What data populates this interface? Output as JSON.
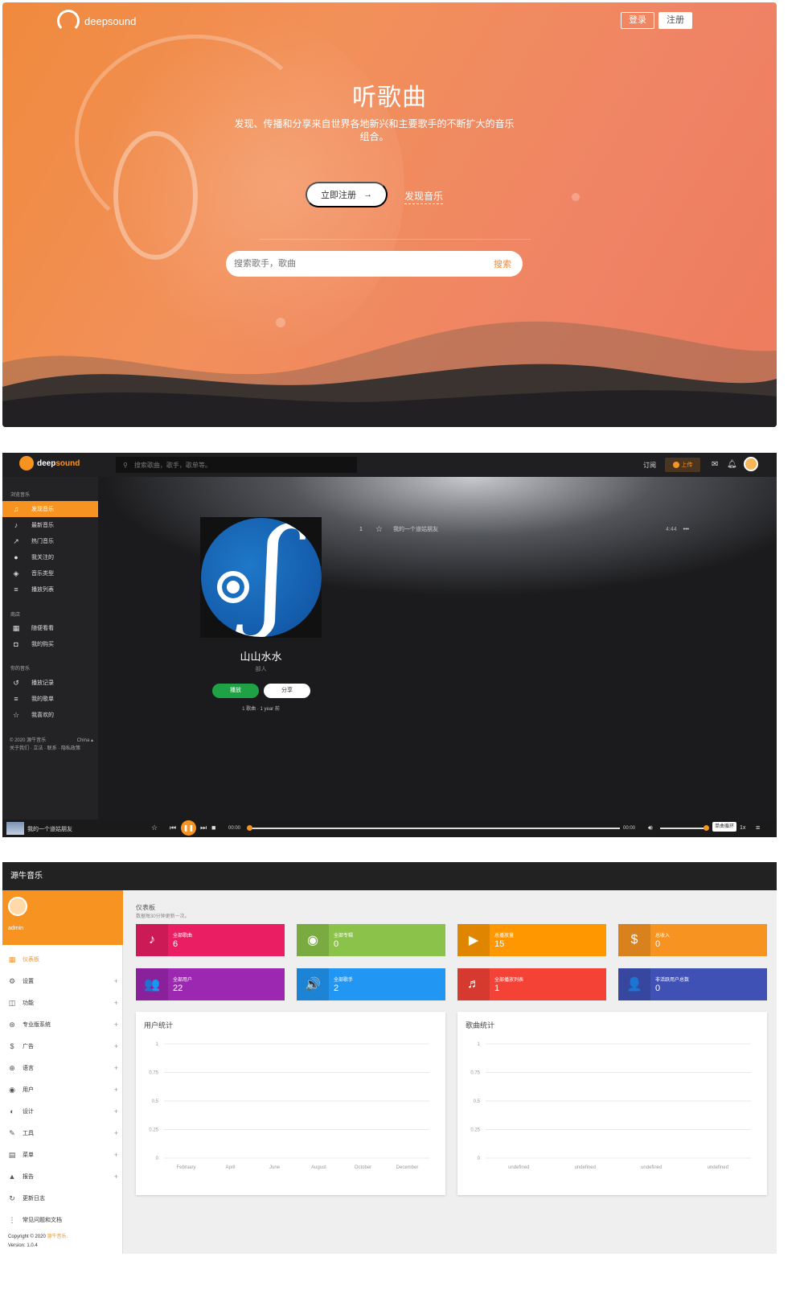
{
  "hero": {
    "brand": "deepsound",
    "login": "登录",
    "register": "注册",
    "title": "听歌曲",
    "subtitle": "发现、传播和分享来自世界各地新兴和主要歌手的不断扩大的音乐组合。",
    "cta": "立即注册",
    "discover": "发现音乐",
    "search_placeholder": "搜索歌手，歌曲",
    "search_button": "搜索"
  },
  "player": {
    "brand_a": "deep",
    "brand_b": "sound",
    "search_placeholder": "搜索歌曲，歌手，歌单等。",
    "subscribe": "订阅",
    "upload": "上传",
    "sections": [
      "浏览音乐",
      "商店",
      "你的音乐"
    ],
    "nav_browse": [
      "发现音乐",
      "最新音乐",
      "热门音乐",
      "我关注的",
      "音乐类型",
      "播放列表"
    ],
    "nav_store": [
      "随便看看",
      "我的购买"
    ],
    "nav_mine": [
      "播放记录",
      "我的歌单",
      "我喜欢的"
    ],
    "footer_line1": "© 2020 源牛音乐",
    "footer_region": "China ▴",
    "footer_line2": "关于我们 · 立法 · 联系 · 隐私政策",
    "album_title": "山山水水",
    "album_artist": "部人",
    "play": "播放",
    "share": "分享",
    "album_meta": "1 歌曲 · 1 year 前",
    "track": {
      "num": "1",
      "title": "我的一个道姑朋友",
      "duration": "4:44",
      "more": "•••"
    },
    "now_playing": "我的一个道姑朋友",
    "time_start": "00:00",
    "time_end": "00:00",
    "tooltip": "单曲循环",
    "speed": "1x",
    "progress": 0,
    "volume": 1
  },
  "admin": {
    "title": "源牛音乐",
    "user": "admin",
    "nav": [
      {
        "icon": "▦",
        "label": "仪表板",
        "plus": ""
      },
      {
        "icon": "⚙",
        "label": "设置",
        "plus": "+"
      },
      {
        "icon": "◫",
        "label": "功能",
        "plus": "+"
      },
      {
        "icon": "⊛",
        "label": "专业版系统",
        "plus": "+"
      },
      {
        "icon": "$",
        "label": "广告",
        "plus": "+"
      },
      {
        "icon": "⊕",
        "label": "语言",
        "plus": "+"
      },
      {
        "icon": "◉",
        "label": "用户",
        "plus": "+"
      },
      {
        "icon": "◐",
        "label": "设计",
        "plus": "+"
      },
      {
        "icon": "✎",
        "label": "工具",
        "plus": "+"
      },
      {
        "icon": "▤",
        "label": "菜单",
        "plus": "+"
      },
      {
        "icon": "▲",
        "label": "报告",
        "plus": "+"
      },
      {
        "icon": "↻",
        "label": "更新日志",
        "plus": ""
      },
      {
        "icon": "⋮",
        "label": "常见问题和文档",
        "plus": ""
      }
    ],
    "copyright_a": "Copyright © 2020 ",
    "copyright_b": "源牛音乐.",
    "version": "Version: 1.0.4",
    "crumb": "仪表板",
    "crumb_sub": "数据每30分钟更新一次。",
    "cards": [
      {
        "label": "全部歌曲",
        "value": "6",
        "color": "#e91e63",
        "icon": "♪"
      },
      {
        "label": "全部专辑",
        "value": "0",
        "color": "#8bc34a",
        "icon": "◉"
      },
      {
        "label": "总播放量",
        "value": "15",
        "color": "#ff9800",
        "icon": "▶"
      },
      {
        "label": "总收入",
        "value": "0",
        "color": "#f79421",
        "icon": "$"
      },
      {
        "label": "全部用户",
        "value": "22",
        "color": "#9c27b0",
        "icon": "👥"
      },
      {
        "label": "全部歌手",
        "value": "2",
        "color": "#2196f3",
        "icon": "🔊"
      },
      {
        "label": "全部播放列表",
        "value": "1",
        "color": "#f44336",
        "icon": "♬"
      },
      {
        "label": "非活跃用户总数",
        "value": "0",
        "color": "#3f51b5",
        "icon": "👤"
      }
    ],
    "user_chart_title": "用户统计",
    "song_chart_title": "歌曲统计"
  },
  "chart_data": [
    {
      "type": "line",
      "title": "用户统计",
      "x": [
        "February",
        "April",
        "June",
        "August",
        "October",
        "December"
      ],
      "yticks": [
        "1",
        "0.75",
        "0.5",
        "0.25",
        "0"
      ],
      "ylim": [
        0,
        1
      ],
      "series": [],
      "grid": true
    },
    {
      "type": "line",
      "title": "歌曲统计",
      "x": [
        "undefined",
        "undefined",
        "undefined",
        "undefined"
      ],
      "yticks": [
        "1",
        "0.75",
        "0.5",
        "0.25",
        "0"
      ],
      "ylim": [
        0,
        1
      ],
      "series": [],
      "grid": true
    }
  ]
}
